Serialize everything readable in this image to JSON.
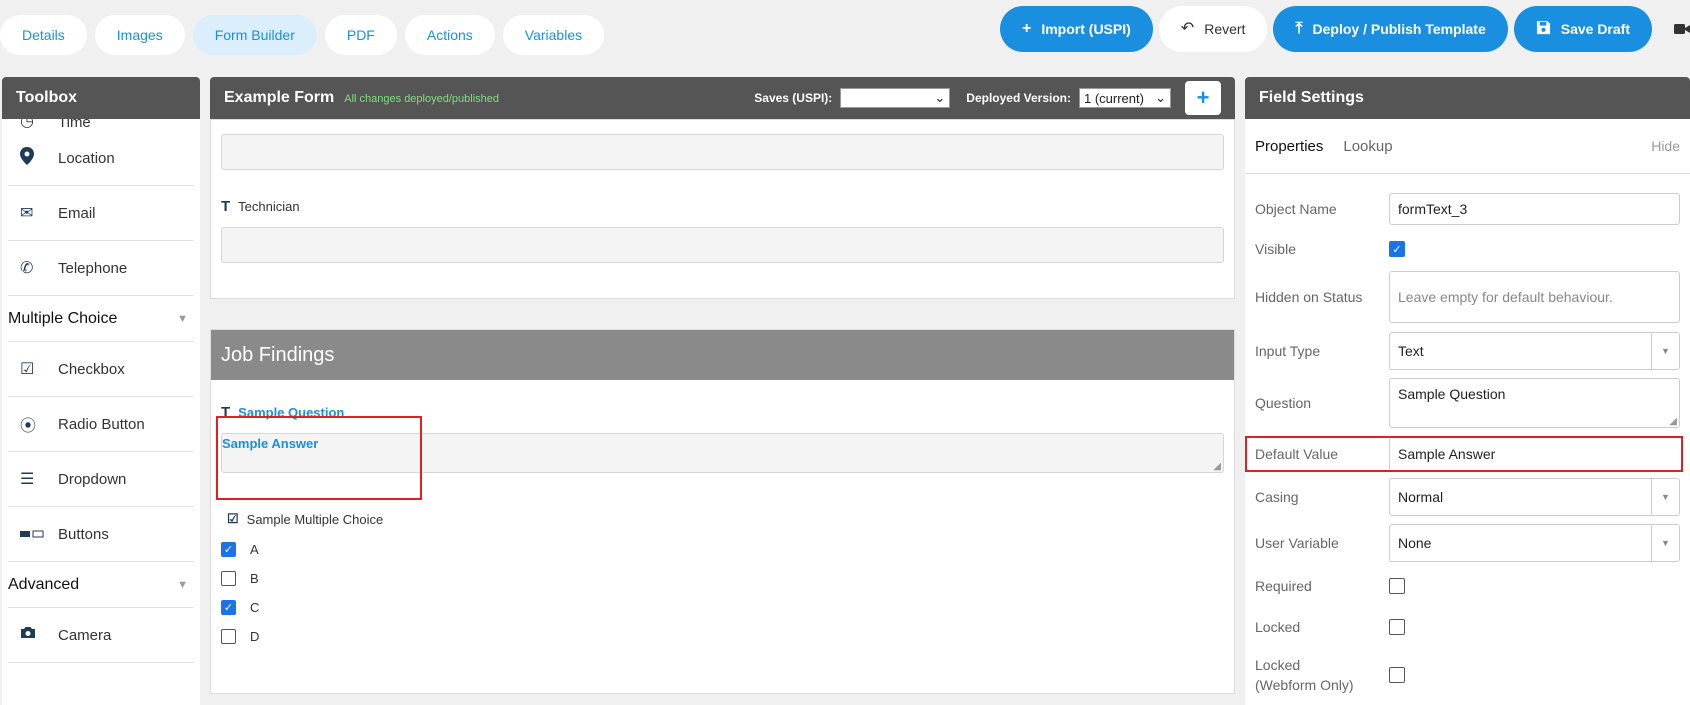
{
  "tabs": [
    "Details",
    "Images",
    "Form Builder",
    "PDF",
    "Actions",
    "Variables"
  ],
  "actions": {
    "import": "Import (USPI)",
    "revert": "Revert",
    "deploy": "Deploy / Publish Template",
    "save": "Save Draft"
  },
  "toolbox": {
    "title": "Toolbox",
    "partial_item": "Time",
    "items_a": [
      "Location",
      "Email",
      "Telephone"
    ],
    "group_multiple": "Multiple Choice",
    "items_b": [
      "Checkbox",
      "Radio Button",
      "Dropdown",
      "Buttons"
    ],
    "group_advanced": "Advanced",
    "items_c": [
      "Camera"
    ]
  },
  "form": {
    "title": "Example Form",
    "status": "All changes deployed/published",
    "saves_label": "Saves (USPI):",
    "saves_value": "",
    "deployed_label": "Deployed Version:",
    "deployed_value": "1 (current)",
    "plus": "+",
    "technician_label": "Technician",
    "section_title": "Job Findings",
    "question_label": "Sample Question",
    "answer_value": "Sample Answer",
    "mc_label": "Sample Multiple Choice",
    "options": [
      {
        "label": "A",
        "checked": true
      },
      {
        "label": "B",
        "checked": false
      },
      {
        "label": "C",
        "checked": true
      },
      {
        "label": "D",
        "checked": false
      }
    ]
  },
  "settings": {
    "title": "Field Settings",
    "tab_properties": "Properties",
    "tab_lookup": "Lookup",
    "hide": "Hide",
    "object_name_label": "Object Name",
    "object_name_value": "formText_3",
    "visible_label": "Visible",
    "hidden_status_label": "Hidden on Status",
    "hidden_status_placeholder": "Leave empty for default behaviour.",
    "input_type_label": "Input Type",
    "input_type_value": "Text",
    "question_label": "Question",
    "question_value": "Sample Question",
    "default_label": "Default Value",
    "default_value": "Sample Answer",
    "casing_label": "Casing",
    "casing_value": "Normal",
    "user_var_label": "User Variable",
    "user_var_value": "None",
    "required_label": "Required",
    "locked_label": "Locked",
    "locked_web_label": "Locked\n(Webform Only)"
  }
}
